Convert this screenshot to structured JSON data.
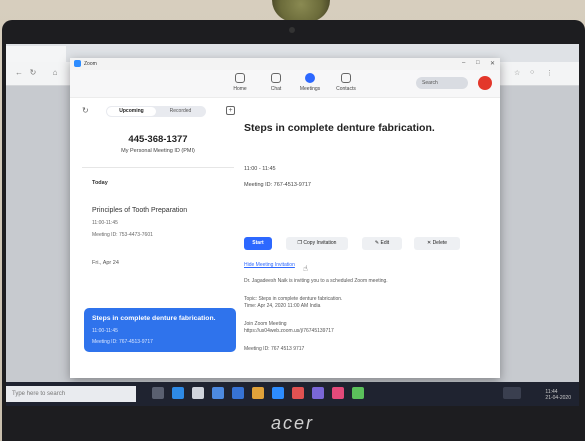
{
  "zoom_window": {
    "title": "Zoom",
    "nav": [
      {
        "label": "Home",
        "icon": "home-icon"
      },
      {
        "label": "Chat",
        "icon": "chat-icon"
      },
      {
        "label": "Meetings",
        "icon": "meetings-icon",
        "active": true
      },
      {
        "label": "Contacts",
        "icon": "contacts-icon"
      }
    ],
    "search": {
      "label": "Search"
    }
  },
  "left_panel": {
    "tabs": [
      {
        "label": "Upcoming",
        "selected": true
      },
      {
        "label": "Recorded",
        "selected": false
      }
    ],
    "pmi": {
      "number": "445-368-1377",
      "label": "My Personal Meeting ID (PMI)"
    },
    "sections": [
      {
        "label": "Today",
        "meetings": [
          {
            "title": "Principles of Tooth Preparation",
            "time": "11:00-11:45",
            "meeting_id": "Meeting ID: 753-4473-7601"
          }
        ]
      },
      {
        "label": "Fri., Apr 24",
        "meetings": [
          {
            "title": "Steps in complete denture fabrication.",
            "time": "11:00-11:45",
            "meeting_id": "Meeting ID: 767-4513-9717",
            "selected": true
          }
        ]
      }
    ]
  },
  "detail": {
    "title": "Steps in complete denture fabrication.",
    "time": "11:00 - 11:45",
    "meeting_id": "Meeting ID: 767-4513-9717",
    "buttons": {
      "start": "Start",
      "copy": "Copy Invitation",
      "edit": "Edit",
      "delete": "Delete"
    },
    "hide_invitation": "Hide Meeting Invitation",
    "invitation": {
      "line1": "Dr. Jagadeesh Naik is inviting you to a scheduled Zoom meeting.",
      "line2": "Topic: Steps in complete denture fabrication.",
      "line3": "Time: Apr 24, 2020 11:00 AM India",
      "line4": "Join Zoom Meeting",
      "line5": "https://us04web.zoom.us/j/76745139717",
      "line6": "Meeting ID: 767 4513 9717"
    }
  },
  "taskbar": {
    "search_placeholder": "Type here to search",
    "time": "11:44",
    "date": "21-04-2020"
  },
  "device": {
    "brand": "acer"
  },
  "colors": {
    "accent": "#2d68ff",
    "selected_card": "#2f73ec",
    "avatar": "#e3372b"
  }
}
